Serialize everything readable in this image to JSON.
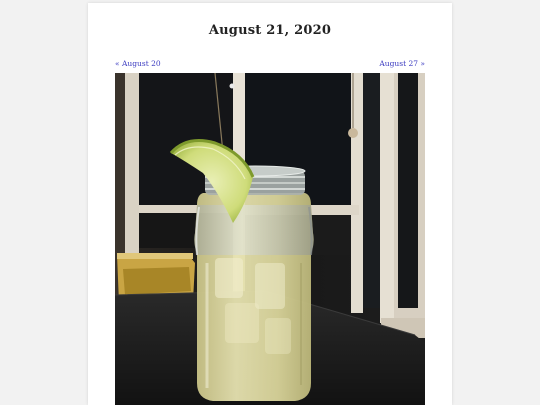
{
  "post": {
    "title": "August 21, 2020",
    "prev_label": "« August 20",
    "next_label": "August 27 »"
  },
  "photo": {
    "subject": "mason jar cocktail with lime wedge",
    "colors": {
      "window_frame": "#e8e2d6",
      "night_sky": "#141a20",
      "counter": "#1c1c1c",
      "drink": "#d8d49a",
      "lime": "#c9d66a"
    }
  },
  "colors": {
    "link": "#3a3ac0",
    "title": "#222222",
    "background": "#f2f2f2",
    "card": "#ffffff"
  }
}
